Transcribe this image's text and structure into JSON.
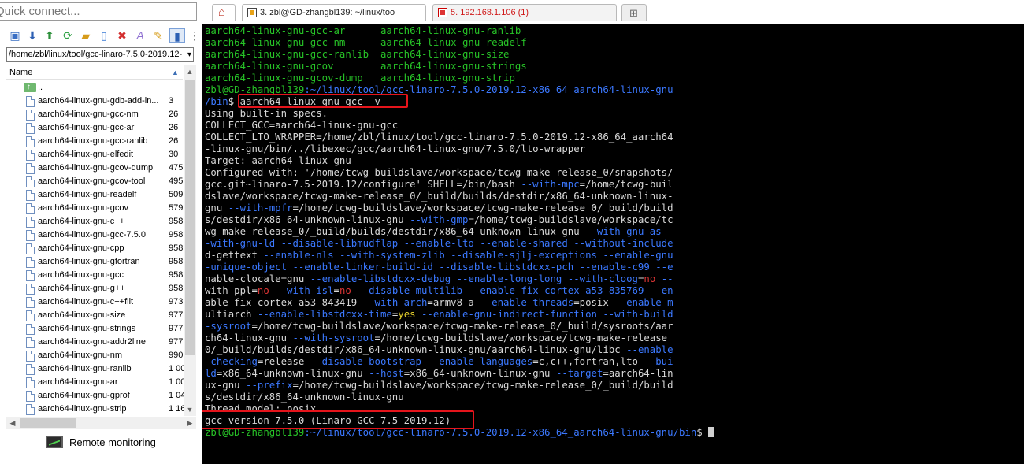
{
  "left_panel": {
    "quick_connect_placeholder": "Quick connect...",
    "path": "/home/zbl/linux/tool/gcc-linaro-7.5.0-2019.12-",
    "column_name": "Name",
    "up_dir": "..",
    "files": [
      {
        "name": "aarch64-linux-gnu-gdb-add-in...",
        "size": "3"
      },
      {
        "name": "aarch64-linux-gnu-gcc-nm",
        "size": "26"
      },
      {
        "name": "aarch64-linux-gnu-gcc-ar",
        "size": "26"
      },
      {
        "name": "aarch64-linux-gnu-gcc-ranlib",
        "size": "26"
      },
      {
        "name": "aarch64-linux-gnu-elfedit",
        "size": "30"
      },
      {
        "name": "aarch64-linux-gnu-gcov-dump",
        "size": "475"
      },
      {
        "name": "aarch64-linux-gnu-gcov-tool",
        "size": "495"
      },
      {
        "name": "aarch64-linux-gnu-readelf",
        "size": "509"
      },
      {
        "name": "aarch64-linux-gnu-gcov",
        "size": "579"
      },
      {
        "name": "aarch64-linux-gnu-c++",
        "size": "958"
      },
      {
        "name": "aarch64-linux-gnu-gcc-7.5.0",
        "size": "958"
      },
      {
        "name": "aarch64-linux-gnu-cpp",
        "size": "958"
      },
      {
        "name": "aarch64-linux-gnu-gfortran",
        "size": "958"
      },
      {
        "name": "aarch64-linux-gnu-gcc",
        "size": "958"
      },
      {
        "name": "aarch64-linux-gnu-g++",
        "size": "958"
      },
      {
        "name": "aarch64-linux-gnu-c++filt",
        "size": "973"
      },
      {
        "name": "aarch64-linux-gnu-size",
        "size": "977"
      },
      {
        "name": "aarch64-linux-gnu-strings",
        "size": "977"
      },
      {
        "name": "aarch64-linux-gnu-addr2line",
        "size": "977"
      },
      {
        "name": "aarch64-linux-gnu-nm",
        "size": "990"
      },
      {
        "name": "aarch64-linux-gnu-ranlib",
        "size": "1 00"
      },
      {
        "name": "aarch64-linux-gnu-ar",
        "size": "1 00"
      },
      {
        "name": "aarch64-linux-gnu-gprof",
        "size": "1 04"
      },
      {
        "name": "aarch64-linux-gnu-strip",
        "size": "1 16"
      }
    ],
    "remote_monitoring": "Remote monitoring",
    "icons": [
      "folder-up-icon",
      "download-icon",
      "upload-icon",
      "refresh-icon",
      "new-folder-icon",
      "new-file-icon",
      "delete-icon",
      "rename-icon",
      "properties-icon",
      "settings-icon",
      "toggle-icon"
    ]
  },
  "tabs": [
    {
      "title": "3. zbl@GD-zhangbl139: ~/linux/too"
    },
    {
      "title": "5. 192.168.1.106 (1)"
    }
  ],
  "terminal": {
    "lines": [
      [
        {
          "t": "aarch64-linux-gnu-gcc-ar      ",
          "c": "g"
        },
        {
          "t": "aarch64-linux-gnu-ranlib",
          "c": "g"
        }
      ],
      [
        {
          "t": "aarch64-linux-gnu-gcc-nm      ",
          "c": "g"
        },
        {
          "t": "aarch64-linux-gnu-readelf",
          "c": "g"
        }
      ],
      [
        {
          "t": "aarch64-linux-gnu-gcc-ranlib  ",
          "c": "g"
        },
        {
          "t": "aarch64-linux-gnu-size",
          "c": "g"
        }
      ],
      [
        {
          "t": "aarch64-linux-gnu-gcov        ",
          "c": "g"
        },
        {
          "t": "aarch64-linux-gnu-strings",
          "c": "g"
        }
      ],
      [
        {
          "t": "aarch64-linux-gnu-gcov-dump   ",
          "c": "g"
        },
        {
          "t": "aarch64-linux-gnu-strip",
          "c": "g"
        }
      ],
      [
        {
          "t": "zbl@GD-zhangbl139",
          "c": "g"
        },
        {
          "t": ":~/linux/tool/gcc-linaro-7.5.0-2019.12-x86_64_aarch64-linux-gnu",
          "c": "b"
        }
      ],
      [
        {
          "t": "/bin",
          "c": "b"
        },
        {
          "t": "$ aarch64-linux-gnu-gcc -v",
          "c": "w"
        }
      ],
      [
        {
          "t": "Using built-in specs.",
          "c": "w"
        }
      ],
      [
        {
          "t": "COLLECT_GCC=aarch64-linux-gnu-gcc",
          "c": "w"
        }
      ],
      [
        {
          "t": "COLLECT_LTO_WRAPPER=/home/zbl/linux/tool/gcc-linaro-7.5.0-2019.12-x86_64_aarch64",
          "c": "w"
        }
      ],
      [
        {
          "t": "-linux-gnu/bin/../libexec/gcc/aarch64-linux-gnu/7.5.0/lto-wrapper",
          "c": "w"
        }
      ],
      [
        {
          "t": "Target: aarch64-linux-gnu",
          "c": "w"
        }
      ],
      [
        {
          "t": "Configured with: '/home/tcwg-buildslave/workspace/tcwg-make-release_0/snapshots/",
          "c": "w"
        }
      ],
      [
        {
          "t": "gcc.git~linaro-7.5-2019.12/configure' SHELL=/bin/bash ",
          "c": "w"
        },
        {
          "t": "--with-mpc",
          "c": "b"
        },
        {
          "t": "=/home/tcwg-buil",
          "c": "w"
        }
      ],
      [
        {
          "t": "dslave/workspace/tcwg-make-release_0/_build/builds/destdir/x86_64-unknown-linux-",
          "c": "w"
        }
      ],
      [
        {
          "t": "gnu ",
          "c": "w"
        },
        {
          "t": "--with-mpfr",
          "c": "b"
        },
        {
          "t": "=/home/tcwg-buildslave/workspace/tcwg-make-release_0/_build/build",
          "c": "w"
        }
      ],
      [
        {
          "t": "s/destdir/x86_64-unknown-linux-gnu ",
          "c": "w"
        },
        {
          "t": "--with-gmp",
          "c": "b"
        },
        {
          "t": "=/home/tcwg-buildslave/workspace/tc",
          "c": "w"
        }
      ],
      [
        {
          "t": "wg-make-release_0/_build/builds/destdir/x86_64-unknown-linux-gnu ",
          "c": "w"
        },
        {
          "t": "--with-gnu-as -",
          "c": "b"
        }
      ],
      [
        {
          "t": "-with-gnu-ld --disable-libmudflap --enable-lto --enable-shared --without-include",
          "c": "b"
        }
      ],
      [
        {
          "t": "d-gettext ",
          "c": "w"
        },
        {
          "t": "--enable-nls --with-system-zlib --disable-sjlj-exceptions --enable-gnu",
          "c": "b"
        }
      ],
      [
        {
          "t": "-unique-object --enable-linker-build-id --disable-libstdcxx-pch --enable-c99 --e",
          "c": "b"
        }
      ],
      [
        {
          "t": "nable-clocale",
          "c": "w"
        },
        {
          "t": "=gnu ",
          "c": "w"
        },
        {
          "t": "--enable-libstdcxx-debug --enable-long-long --with-cloog",
          "c": "b"
        },
        {
          "t": "=",
          "c": "w"
        },
        {
          "t": "no",
          "c": "r"
        },
        {
          "t": " --",
          "c": "b"
        }
      ],
      [
        {
          "t": "with-ppl",
          "c": "w"
        },
        {
          "t": "=",
          "c": "w"
        },
        {
          "t": "no",
          "c": "r"
        },
        {
          "t": " --with-isl",
          "c": "b"
        },
        {
          "t": "=",
          "c": "w"
        },
        {
          "t": "no",
          "c": "r"
        },
        {
          "t": " --disable-multilib --enable-fix-cortex-a53-835769 --en",
          "c": "b"
        }
      ],
      [
        {
          "t": "able-fix-cortex-a53-843419 ",
          "c": "w"
        },
        {
          "t": "--with-arch",
          "c": "b"
        },
        {
          "t": "=armv8-a ",
          "c": "w"
        },
        {
          "t": "--enable-threads",
          "c": "b"
        },
        {
          "t": "=posix ",
          "c": "w"
        },
        {
          "t": "--enable-m",
          "c": "b"
        }
      ],
      [
        {
          "t": "ultiarch ",
          "c": "w"
        },
        {
          "t": "--enable-libstdcxx-time",
          "c": "b"
        },
        {
          "t": "=",
          "c": "w"
        },
        {
          "t": "yes",
          "c": "y"
        },
        {
          "t": " --enable-gnu-indirect-function --with-build",
          "c": "b"
        }
      ],
      [
        {
          "t": "-sysroot",
          "c": "b"
        },
        {
          "t": "=/home/tcwg-buildslave/workspace/tcwg-make-release_0/_build/sysroots/aar",
          "c": "w"
        }
      ],
      [
        {
          "t": "ch64-linux-gnu ",
          "c": "w"
        },
        {
          "t": "--with-sysroot",
          "c": "b"
        },
        {
          "t": "=/home/tcwg-buildslave/workspace/tcwg-make-release_",
          "c": "w"
        }
      ],
      [
        {
          "t": "0/_build/builds/destdir/x86_64-unknown-linux-gnu/aarch64-linux-gnu/libc ",
          "c": "w"
        },
        {
          "t": "--enable",
          "c": "b"
        }
      ],
      [
        {
          "t": "-checking",
          "c": "b"
        },
        {
          "t": "=release ",
          "c": "w"
        },
        {
          "t": "--disable-bootstrap --enable-languages",
          "c": "b"
        },
        {
          "t": "=c,c++,fortran,lto ",
          "c": "w"
        },
        {
          "t": "--bui",
          "c": "b"
        }
      ],
      [
        {
          "t": "ld",
          "c": "b"
        },
        {
          "t": "=x86_64-unknown-linux-gnu ",
          "c": "w"
        },
        {
          "t": "--host",
          "c": "b"
        },
        {
          "t": "=x86_64-unknown-linux-gnu ",
          "c": "w"
        },
        {
          "t": "--target",
          "c": "b"
        },
        {
          "t": "=aarch64-lin",
          "c": "w"
        }
      ],
      [
        {
          "t": "ux-gnu ",
          "c": "w"
        },
        {
          "t": "--prefix",
          "c": "b"
        },
        {
          "t": "=/home/tcwg-buildslave/workspace/tcwg-make-release_0/_build/build",
          "c": "w"
        }
      ],
      [
        {
          "t": "s/destdir/x86_64-unknown-linux-gnu",
          "c": "w"
        }
      ],
      [
        {
          "t": "Thread model: posix",
          "c": "w"
        }
      ],
      [
        {
          "t": "gcc version 7.5.0 (Linaro GCC 7.5-2019.12)",
          "c": "w"
        }
      ],
      [
        {
          "t": "zbl@GD-zhangbl139",
          "c": "g"
        },
        {
          "t": ":~/linux/tool/gcc-linaro-7.5.0-2019.12-x86_64_aarch64-linux-gnu/bin",
          "c": "b"
        },
        {
          "t": "$ ",
          "c": "w"
        }
      ]
    ]
  }
}
